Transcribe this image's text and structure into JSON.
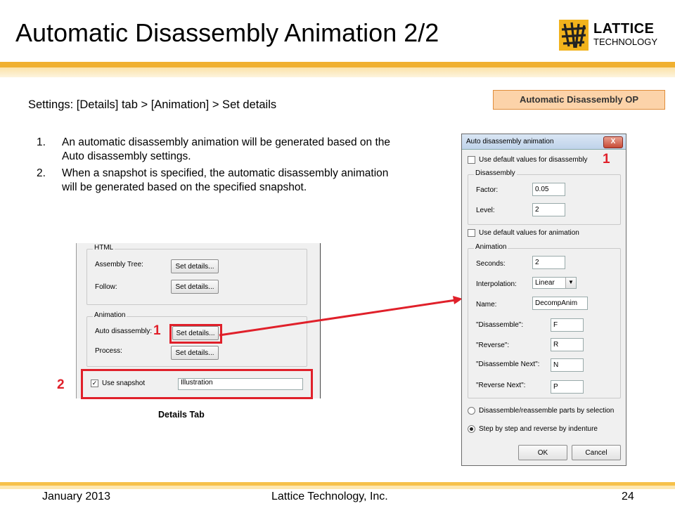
{
  "slide": {
    "title": "Automatic Disassembly Animation 2/2",
    "logo": {
      "line1": "LATTICE",
      "line2": "TECHNOLOGY"
    },
    "op_label": "Automatic Disassembly OP",
    "subtitle": "Settings: [Details] tab > [Animation] > Set details",
    "list": [
      {
        "num": "1.",
        "text": "An automatic disassembly animation will be generated based on the Auto disassembly settings."
      },
      {
        "num": "2.",
        "text": "When a snapshot is specified, the automatic disassembly animation will be generated based on the specified snapshot."
      }
    ],
    "caption": "Details Tab",
    "markers": {
      "one": "1",
      "two": "2",
      "dialog_one": "1"
    },
    "footer": {
      "date": "January 2013",
      "company": "Lattice Technology, Inc.",
      "page": "24"
    }
  },
  "details_tab": {
    "html_group": "HTML",
    "assembly_tree_label": "Assembly Tree:",
    "follow_label": "Follow:",
    "animation_group": "Animation",
    "auto_disassembly_label": "Auto disassembly:",
    "process_label": "Process:",
    "set_details": "Set details...",
    "use_snapshot_label": "Use snapshot",
    "use_snapshot_checked": true,
    "snapshot_value": "Illustration"
  },
  "dialog": {
    "title": "Auto disassembly animation",
    "close": "X",
    "use_default_disassembly": "Use default values for disassembly",
    "disassembly_group": "Disassembly",
    "factor_label": "Factor:",
    "factor_value": "0.05",
    "level_label": "Level:",
    "level_value": "2",
    "use_default_animation": "Use default values for animation",
    "animation_group": "Animation",
    "seconds_label": "Seconds:",
    "seconds_value": "2",
    "interpolation_label": "Interpolation:",
    "interpolation_value": "Linear",
    "name_label": "Name:",
    "name_value": "DecompAnim",
    "disassemble_label": "\"Disassemble\":",
    "disassemble_value": "F",
    "reverse_label": "\"Reverse\":",
    "reverse_value": "R",
    "disassemble_next_label": "\"Disassemble Next\":",
    "disassemble_next_value": "N",
    "reverse_next_label": "\"Reverse Next\":",
    "reverse_next_value": "P",
    "radio1": "Disassemble/reassemble parts by selection",
    "radio2": "Step by step and reverse by indenture",
    "ok": "OK",
    "cancel": "Cancel"
  },
  "colors": {
    "accent_red": "#e0202a",
    "bar_orange": "#f0b030",
    "label_fill": "#fcd3a9"
  }
}
